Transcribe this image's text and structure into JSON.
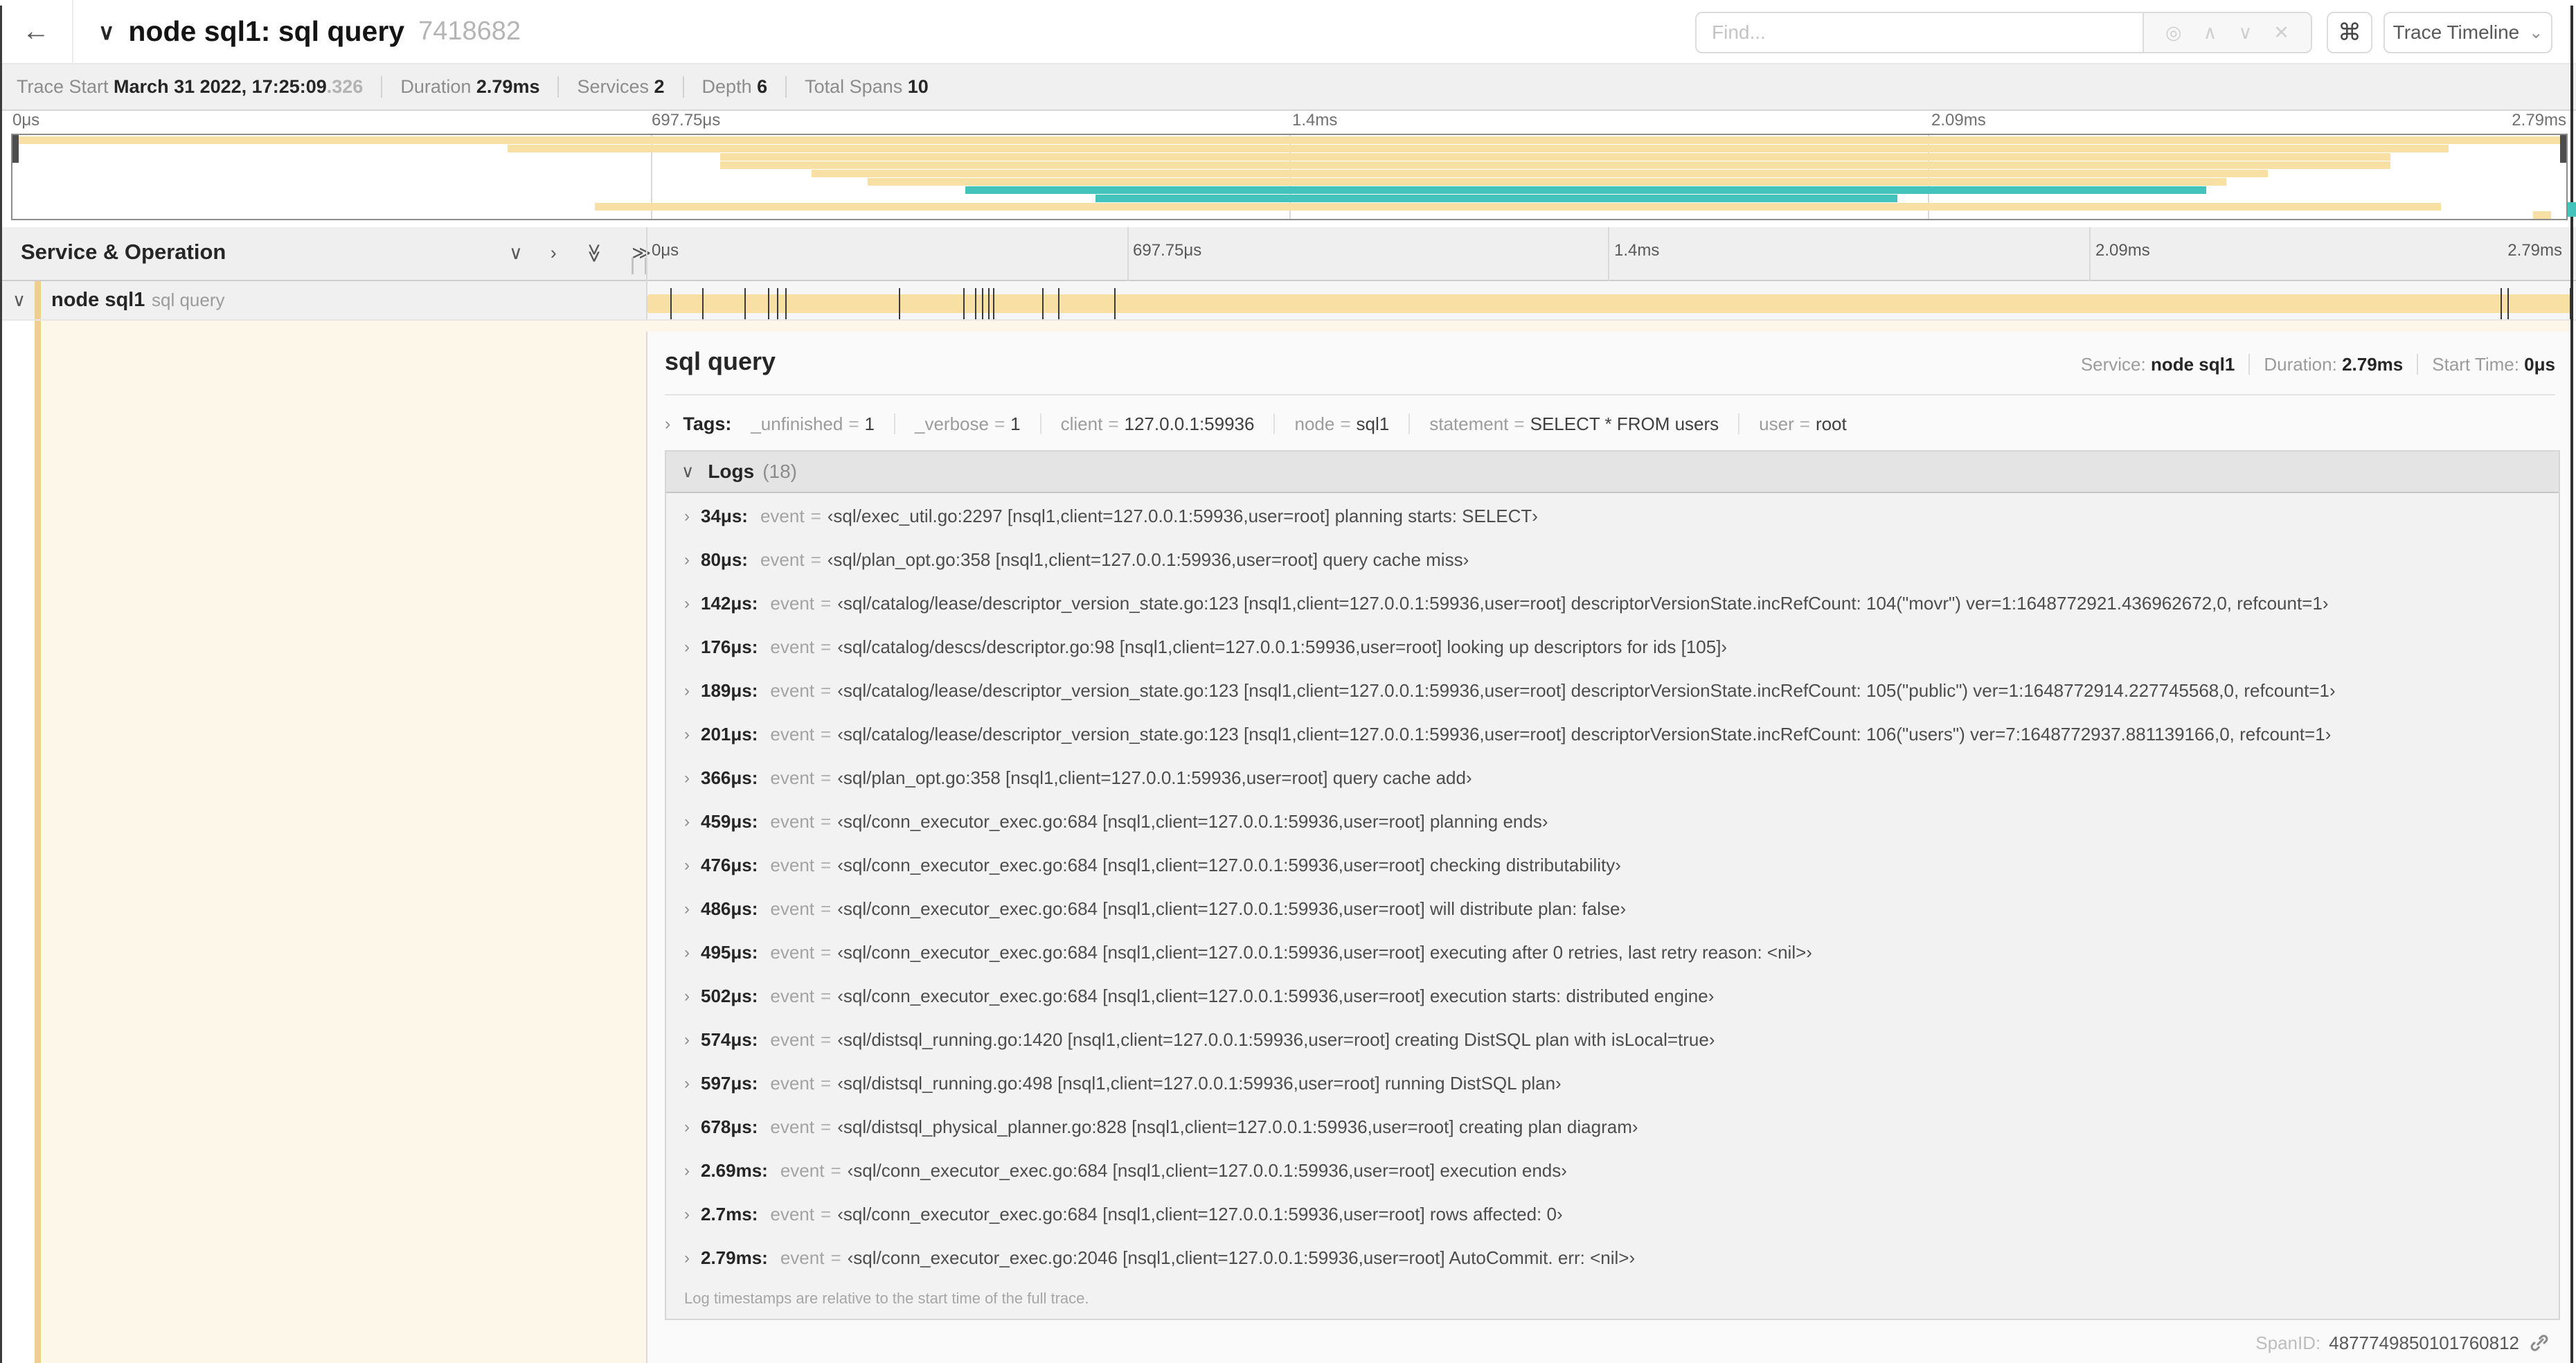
{
  "header": {
    "title": "node sql1: sql query",
    "trace_id": "7418682",
    "find_placeholder": "Find...",
    "shortcut_label": "⌘",
    "view_selector_label": "Trace Timeline"
  },
  "icons": {
    "back": "←",
    "title_chevron": "∨",
    "locate": "◎",
    "prev": "∧",
    "next": "∨",
    "clear": "✕",
    "dropdown": "⌄",
    "chevron_down": "∨",
    "chevron_right": "›",
    "double_chevron": "≫"
  },
  "trace_meta": [
    {
      "label": "Trace Start",
      "value": "March 31 2022, 17:25:09",
      "suffix": ".326"
    },
    {
      "label": "Duration",
      "value": "2.79ms",
      "suffix": ""
    },
    {
      "label": "Services",
      "value": "2",
      "suffix": ""
    },
    {
      "label": "Depth",
      "value": "6",
      "suffix": ""
    },
    {
      "label": "Total Spans",
      "value": "10",
      "suffix": ""
    }
  ],
  "timeline": {
    "section_header": "Service & Operation",
    "ticks": [
      "0μs",
      "697.75μs",
      "1.4ms",
      "2.09ms",
      "2.79ms"
    ],
    "trace_duration_us": 2790
  },
  "minimap_bars": [
    {
      "start": 0,
      "end": 100,
      "color": "tan"
    },
    {
      "start": 19.4,
      "end": 95.4,
      "color": "tan"
    },
    {
      "start": 27.7,
      "end": 93.1,
      "color": "tan"
    },
    {
      "start": 27.7,
      "end": 93.1,
      "color": "tan"
    },
    {
      "start": 31.3,
      "end": 88.3,
      "color": "tan"
    },
    {
      "start": 33.5,
      "end": 86.7,
      "color": "tan"
    },
    {
      "start": 37.3,
      "end": 85.9,
      "color": "teal"
    },
    {
      "start": 42.4,
      "end": 73.8,
      "color": "teal"
    },
    {
      "start": 22.8,
      "end": 95.1,
      "color": "tan"
    },
    {
      "start": 98.7,
      "end": 99.4,
      "color": "tan"
    }
  ],
  "span_row": {
    "service": "node sql1",
    "operation": "sql query"
  },
  "detail": {
    "title": "sql query",
    "stats": [
      {
        "label": "Service:",
        "value": "node sql1"
      },
      {
        "label": "Duration:",
        "value": "2.79ms"
      },
      {
        "label": "Start Time:",
        "value": "0μs"
      }
    ],
    "tags_label": "Tags:",
    "tags": [
      {
        "key": "_unfinished",
        "value": "1"
      },
      {
        "key": "_verbose",
        "value": "1"
      },
      {
        "key": "client",
        "value": "127.0.0.1:59936"
      },
      {
        "key": "node",
        "value": "sql1"
      },
      {
        "key": "statement",
        "value": "SELECT * FROM users"
      },
      {
        "key": "user",
        "value": "root"
      }
    ],
    "logs_label": "Logs",
    "logs_count": "(18)",
    "log_field_label": "event",
    "logs": [
      {
        "t": "34μs",
        "msg": "‹sql/exec_util.go:2297 [nsql1,client=127.0.0.1:59936,user=root] planning starts: SELECT›"
      },
      {
        "t": "80μs",
        "msg": "‹sql/plan_opt.go:358 [nsql1,client=127.0.0.1:59936,user=root] query cache miss›"
      },
      {
        "t": "142μs",
        "msg": "‹sql/catalog/lease/descriptor_version_state.go:123 [nsql1,client=127.0.0.1:59936,user=root] descriptorVersionState.incRefCount: 104(\"movr\") ver=1:1648772921.436962672,0, refcount=1›"
      },
      {
        "t": "176μs",
        "msg": "‹sql/catalog/descs/descriptor.go:98 [nsql1,client=127.0.0.1:59936,user=root] looking up descriptors for ids [105]›"
      },
      {
        "t": "189μs",
        "msg": "‹sql/catalog/lease/descriptor_version_state.go:123 [nsql1,client=127.0.0.1:59936,user=root] descriptorVersionState.incRefCount: 105(\"public\") ver=1:1648772914.227745568,0, refcount=1›"
      },
      {
        "t": "201μs",
        "msg": "‹sql/catalog/lease/descriptor_version_state.go:123 [nsql1,client=127.0.0.1:59936,user=root] descriptorVersionState.incRefCount: 106(\"users\") ver=7:1648772937.881139166,0, refcount=1›"
      },
      {
        "t": "366μs",
        "msg": "‹sql/plan_opt.go:358 [nsql1,client=127.0.0.1:59936,user=root] query cache add›"
      },
      {
        "t": "459μs",
        "msg": "‹sql/conn_executor_exec.go:684 [nsql1,client=127.0.0.1:59936,user=root] planning ends›"
      },
      {
        "t": "476μs",
        "msg": "‹sql/conn_executor_exec.go:684 [nsql1,client=127.0.0.1:59936,user=root] checking distributability›"
      },
      {
        "t": "486μs",
        "msg": "‹sql/conn_executor_exec.go:684 [nsql1,client=127.0.0.1:59936,user=root] will distribute plan: false›"
      },
      {
        "t": "495μs",
        "msg": "‹sql/conn_executor_exec.go:684 [nsql1,client=127.0.0.1:59936,user=root] executing after 0 retries, last retry reason: <nil>›"
      },
      {
        "t": "502μs",
        "msg": "‹sql/conn_executor_exec.go:684 [nsql1,client=127.0.0.1:59936,user=root] execution starts: distributed engine›"
      },
      {
        "t": "574μs",
        "msg": "‹sql/distsql_running.go:1420 [nsql1,client=127.0.0.1:59936,user=root] creating DistSQL plan with isLocal=true›"
      },
      {
        "t": "597μs",
        "msg": "‹sql/distsql_running.go:498 [nsql1,client=127.0.0.1:59936,user=root] running DistSQL plan›"
      },
      {
        "t": "678μs",
        "msg": "‹sql/distsql_physical_planner.go:828 [nsql1,client=127.0.0.1:59936,user=root] creating plan diagram›"
      },
      {
        "t": "2.69ms",
        "msg": "‹sql/conn_executor_exec.go:684 [nsql1,client=127.0.0.1:59936,user=root] execution ends›"
      },
      {
        "t": "2.7ms",
        "msg": "‹sql/conn_executor_exec.go:684 [nsql1,client=127.0.0.1:59936,user=root] rows affected: 0›"
      },
      {
        "t": "2.79ms",
        "msg": "‹sql/conn_executor_exec.go:2046 [nsql1,client=127.0.0.1:59936,user=root] AutoCommit. err: <nil>›"
      }
    ],
    "logs_footnote": "Log timestamps are relative to the start time of the full trace.",
    "spanid_label": "SpanID:",
    "spanid_value": "4877749850101760812"
  },
  "colors": {
    "tan": "#f8dfa4",
    "tan_stripe": "#f0cf8d",
    "teal": "#44c2bc",
    "cream": "#fdf7e9"
  }
}
